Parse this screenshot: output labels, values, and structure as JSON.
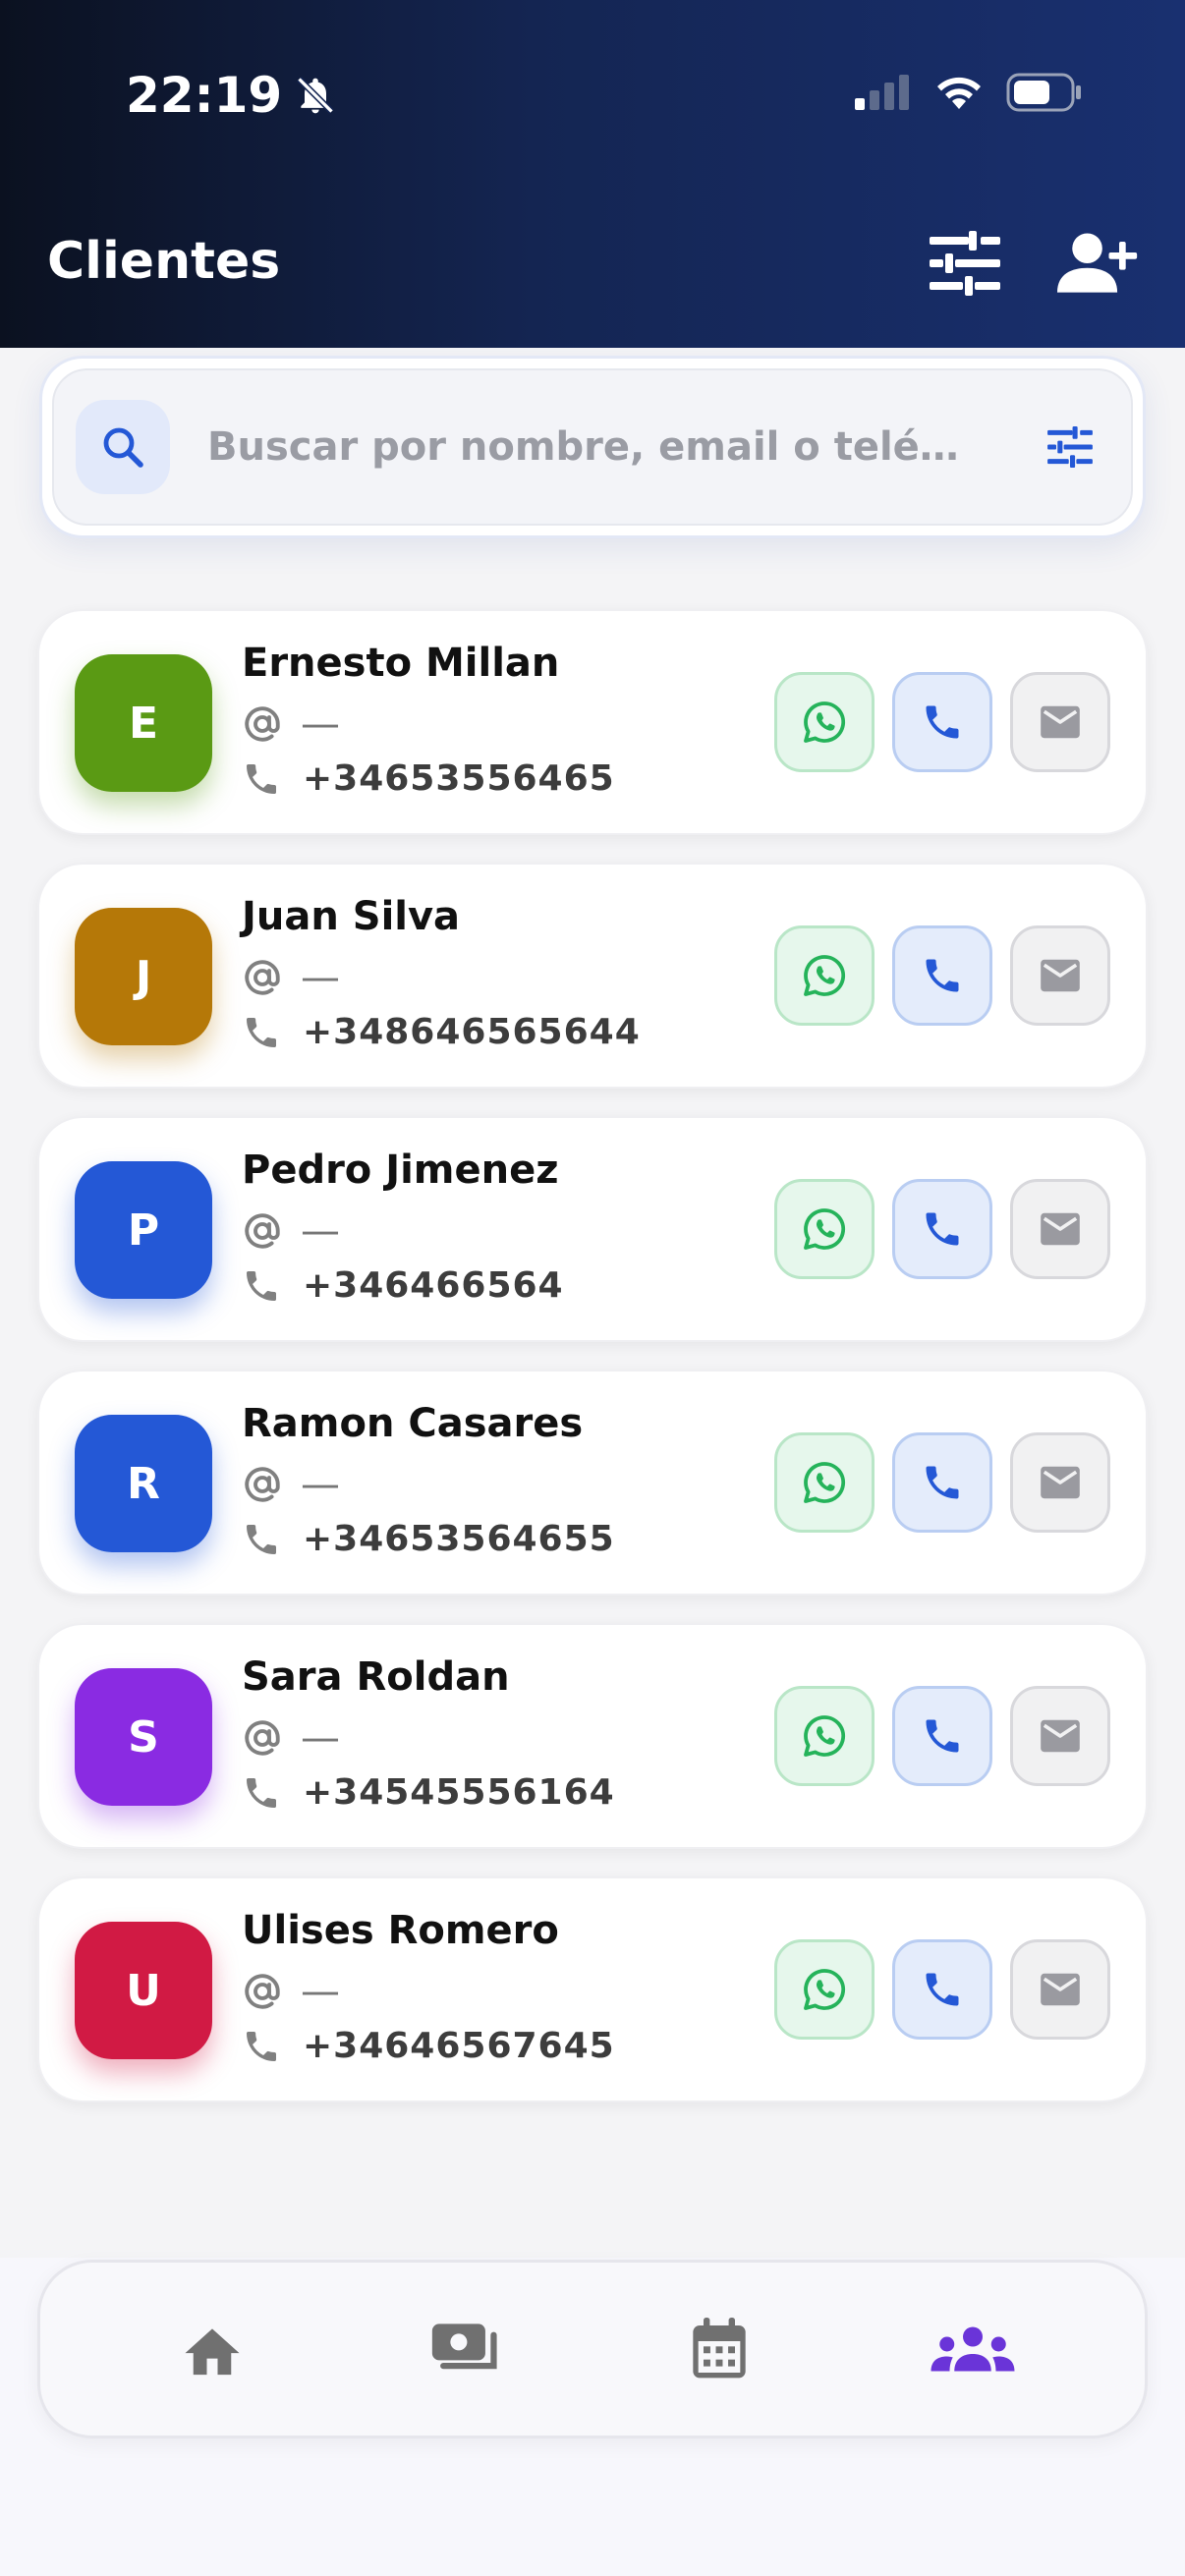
{
  "status_bar": {
    "time": "22:19"
  },
  "header": {
    "title": "Clientes"
  },
  "search": {
    "placeholder": "Buscar por nombre, email o telé…"
  },
  "clients": [
    {
      "initial": "E",
      "name": "Ernesto Millan",
      "email": "—",
      "phone": "+34653556465",
      "color": "#5a9a14"
    },
    {
      "initial": "J",
      "name": "Juan Silva",
      "email": "—",
      "phone": "+348646565644",
      "color": "#b57808"
    },
    {
      "initial": "P",
      "name": "Pedro Jimenez",
      "email": "—",
      "phone": "+346466564",
      "color": "#2458d6"
    },
    {
      "initial": "R",
      "name": "Ramon Casares",
      "email": "—",
      "phone": "+34653564655",
      "color": "#2458d6"
    },
    {
      "initial": "S",
      "name": "Sara Roldan",
      "email": "—",
      "phone": "+34545556164",
      "color": "#8a2be2"
    },
    {
      "initial": "U",
      "name": "Ulises Romero",
      "email": "—",
      "phone": "+34646567645",
      "color": "#d11a44"
    }
  ],
  "colors": {
    "header_start": "#0b1120",
    "header_end": "#193070",
    "accent": "#6a34d8",
    "whatsapp": "#25b35a",
    "call": "#2458d6",
    "mail_disabled": "#9a9aa0"
  },
  "nav": {
    "items": [
      "home-icon",
      "payments-icon",
      "calendar-icon",
      "clients-icon"
    ],
    "active": "clients-icon"
  }
}
